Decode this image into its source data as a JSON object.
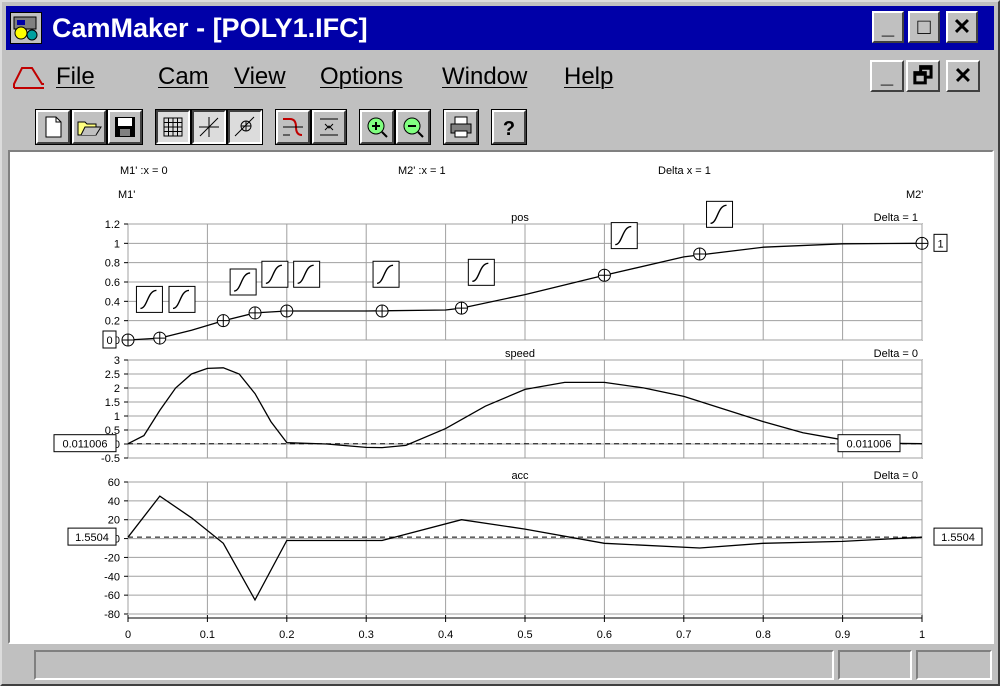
{
  "window": {
    "title": "CamMaker - [POLY1.IFC]"
  },
  "window_controls": {
    "minimize": "_",
    "maximize": "□",
    "close": "✕"
  },
  "mdi_controls": {
    "minimize": "_",
    "restore": "🗗",
    "close": "✕"
  },
  "menu": {
    "items": [
      "File",
      "Cam",
      "View",
      "Options",
      "Window",
      "Help"
    ]
  },
  "toolbar": {
    "buttons": [
      "new-file-icon",
      "open-folder-icon",
      "save-disk-icon",
      "grid-icon",
      "cursor-crosshair-icon",
      "add-point-icon",
      "cam-curve-icon",
      "fit-icon",
      "zoom-in-icon",
      "zoom-out-icon",
      "print-icon",
      "help-icon"
    ],
    "pressed": [
      "grid-icon",
      "cursor-crosshair-icon",
      "add-point-icon"
    ]
  },
  "header": {
    "m1_x": "M1' :x = 0",
    "m2_x": "M2' :x = 1",
    "delta_x": "Delta x = 1",
    "m1": "M1'",
    "m2": "M2'"
  },
  "chart_data": {
    "type": "line",
    "x_ticks": [
      "0",
      "0.1",
      "0.2",
      "0.3",
      "0.4",
      "0.5",
      "0.6",
      "0.7",
      "0.8",
      "0.9",
      "1"
    ],
    "xlim": [
      0,
      1
    ],
    "panels": [
      {
        "name": "pos",
        "delta": "Delta = 1",
        "ylim": [
          0,
          1.2
        ],
        "y_ticks": [
          "1.2",
          "1",
          "0.8",
          "0.6",
          "0.4",
          "0.2",
          "0"
        ],
        "left_box": "0",
        "right_box": "1",
        "x": [
          0,
          0.04,
          0.08,
          0.12,
          0.16,
          0.2,
          0.3,
          0.4,
          0.42,
          0.5,
          0.6,
          0.7,
          0.8,
          0.9,
          1.0
        ],
        "y": [
          0.0,
          0.02,
          0.1,
          0.2,
          0.28,
          0.3,
          0.3,
          0.31,
          0.33,
          0.47,
          0.67,
          0.86,
          0.96,
          0.995,
          1.0
        ],
        "points": [
          {
            "x": 0,
            "y": 0
          },
          {
            "x": 0.04,
            "y": 0.02
          },
          {
            "x": 0.12,
            "y": 0.2
          },
          {
            "x": 0.16,
            "y": 0.28
          },
          {
            "x": 0.2,
            "y": 0.3
          },
          {
            "x": 0.32,
            "y": 0.3
          },
          {
            "x": 0.42,
            "y": 0.33
          },
          {
            "x": 0.6,
            "y": 0.67
          },
          {
            "x": 0.72,
            "y": 0.89
          },
          {
            "x": 1,
            "y": 1
          }
        ],
        "segment_markers": [
          {
            "x": 0.027,
            "y": 0.42
          },
          {
            "x": 0.068,
            "y": 0.42
          },
          {
            "x": 0.145,
            "y": 0.6
          },
          {
            "x": 0.185,
            "y": 0.68
          },
          {
            "x": 0.225,
            "y": 0.68
          },
          {
            "x": 0.325,
            "y": 0.68
          },
          {
            "x": 0.445,
            "y": 0.7
          },
          {
            "x": 0.625,
            "y": 1.08
          },
          {
            "x": 0.745,
            "y": 1.3
          }
        ]
      },
      {
        "name": "speed",
        "delta": "Delta = 0",
        "ylim": [
          -0.5,
          3
        ],
        "y_ticks": [
          "3",
          "2.5",
          "2",
          "1.5",
          "1",
          "0.5",
          "0",
          "-0.5"
        ],
        "left_box": "0.011006",
        "right_box": "0.011006",
        "baseline": 0.011006,
        "x": [
          0,
          0.02,
          0.04,
          0.06,
          0.08,
          0.1,
          0.12,
          0.14,
          0.16,
          0.18,
          0.2,
          0.25,
          0.3,
          0.32,
          0.35,
          0.4,
          0.45,
          0.5,
          0.55,
          0.6,
          0.65,
          0.7,
          0.75,
          0.8,
          0.85,
          0.9,
          0.95,
          1.0
        ],
        "y": [
          0.01,
          0.3,
          1.2,
          2.0,
          2.5,
          2.7,
          2.72,
          2.5,
          1.8,
          0.8,
          0.05,
          0.0,
          -0.12,
          -0.13,
          -0.05,
          0.55,
          1.35,
          1.95,
          2.2,
          2.2,
          2.0,
          1.7,
          1.25,
          0.8,
          0.4,
          0.15,
          0.03,
          0.01
        ]
      },
      {
        "name": "acc",
        "delta": "Delta = 0",
        "ylim": [
          -80,
          60
        ],
        "y_ticks": [
          "60",
          "40",
          "20",
          "0",
          "-20",
          "-40",
          "-60",
          "-80"
        ],
        "left_box": "1.5504",
        "right_box": "1.5504",
        "baseline": 1.5504,
        "x": [
          0,
          0.04,
          0.08,
          0.12,
          0.16,
          0.2,
          0.32,
          0.42,
          0.5,
          0.6,
          0.72,
          0.8,
          0.9,
          1.0
        ],
        "y": [
          1.5,
          45,
          22,
          -5,
          -65,
          -2,
          -2,
          20,
          10,
          -5,
          -10,
          -5,
          -3,
          1.5
        ]
      }
    ]
  }
}
